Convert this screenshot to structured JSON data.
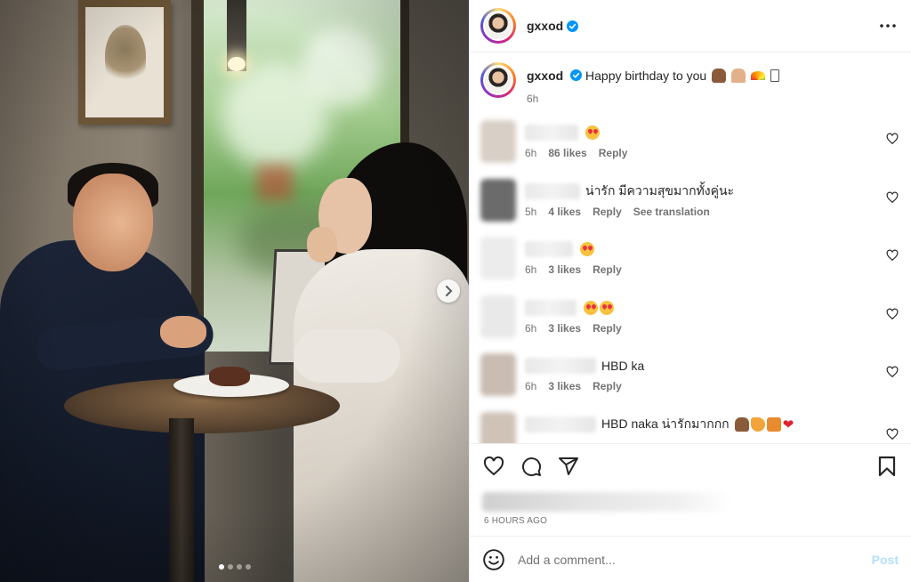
{
  "post": {
    "username": "gxxod",
    "verified": true,
    "caption": "Happy birthday to you",
    "caption_emojis": [
      "cake-emoji",
      "pray-emoji",
      "rainbow-emoji",
      "box-emoji"
    ],
    "caption_time": "6h",
    "timestamp": "6 HOURS AGO",
    "carousel": {
      "total": 4,
      "current": 1
    }
  },
  "comments": [
    {
      "text": "",
      "emojis": [
        "heart-eyes-emoji"
      ],
      "time": "6h",
      "likes": "86 likes",
      "reply": "Reply",
      "translate": ""
    },
    {
      "text": "น่ารัก มีความสุขมากทั้งคู่นะ",
      "emojis": [],
      "time": "5h",
      "likes": "4 likes",
      "reply": "Reply",
      "translate": "See translation"
    },
    {
      "text": "",
      "emojis": [
        "heart-eyes-emoji"
      ],
      "time": "6h",
      "likes": "3 likes",
      "reply": "Reply",
      "translate": ""
    },
    {
      "text": "",
      "emojis": [
        "heart-eyes-emoji",
        "heart-eyes-emoji"
      ],
      "time": "6h",
      "likes": "3 likes",
      "reply": "Reply",
      "translate": ""
    },
    {
      "text": "HBD ka",
      "emojis": [],
      "time": "6h",
      "likes": "3 likes",
      "reply": "Reply",
      "translate": ""
    },
    {
      "text": "HBD naka น่ารักมากกก",
      "emojis": [
        "cake-emoji",
        "party-emoji",
        "gift-emoji",
        "red-heart-emoji"
      ],
      "time": "",
      "likes": "",
      "reply": "",
      "translate": ""
    }
  ],
  "add_comment": {
    "placeholder": "Add a comment...",
    "post_label": "Post"
  },
  "colors": {
    "verified": "#0095f6",
    "post_disabled": "#b2dffc",
    "meta": "#737373",
    "text": "#262626"
  }
}
